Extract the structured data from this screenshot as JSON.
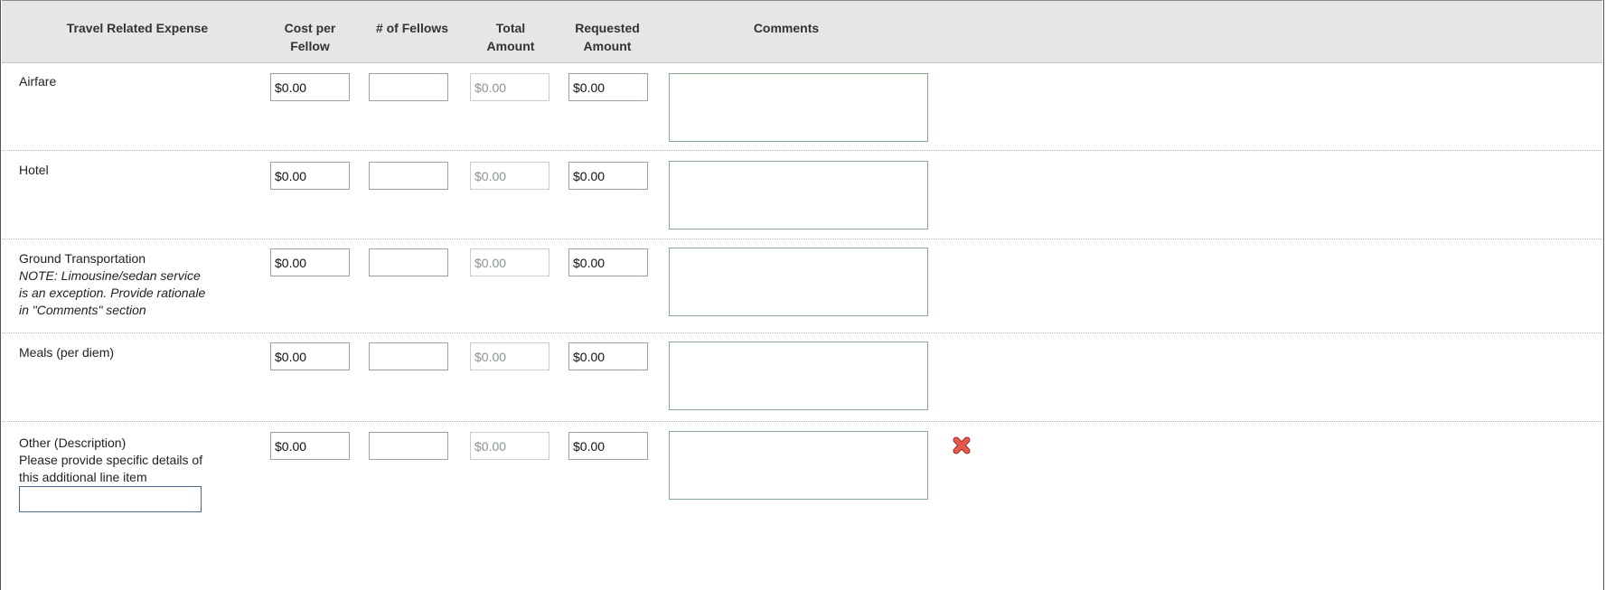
{
  "headers": {
    "expense": "Travel Related Expense",
    "cost_line1": "Cost per",
    "cost_line2": "Fellow",
    "fellows": "# of Fellows",
    "total_line1": "Total",
    "total_line2": "Amount",
    "requested_line1": "Requested",
    "requested_line2": "Amount",
    "comments": "Comments"
  },
  "rows": [
    {
      "label": "Airfare",
      "cost": "$0.00",
      "fellows": "",
      "total": "$0.00",
      "requested": "$0.00",
      "comments": ""
    },
    {
      "label": "Hotel",
      "cost": "$0.00",
      "fellows": "",
      "total": "$0.00",
      "requested": "$0.00",
      "comments": ""
    },
    {
      "label": "Ground Transportation",
      "note_line1": "NOTE: Limousine/sedan service",
      "note_line2": "is an exception. Provide rationale",
      "note_line3": "in \"Comments\" section",
      "cost": "$0.00",
      "fellows": "",
      "total": "$0.00",
      "requested": "$0.00",
      "comments": ""
    },
    {
      "label": "Meals (per diem)",
      "cost": "$0.00",
      "fellows": "",
      "total": "$0.00",
      "requested": "$0.00",
      "comments": ""
    },
    {
      "label": "Other (Description)",
      "help_line1": "Please provide specific details of",
      "help_line2": "this additional line item",
      "description": "",
      "cost": "$0.00",
      "fellows": "",
      "total": "$0.00",
      "requested": "$0.00",
      "comments": ""
    }
  ],
  "icons": {
    "delete": "delete-x-icon"
  },
  "colors": {
    "header_bg": "#e6e6e6",
    "delete_icon": "#d9534f",
    "disabled_text": "#8a9294"
  }
}
